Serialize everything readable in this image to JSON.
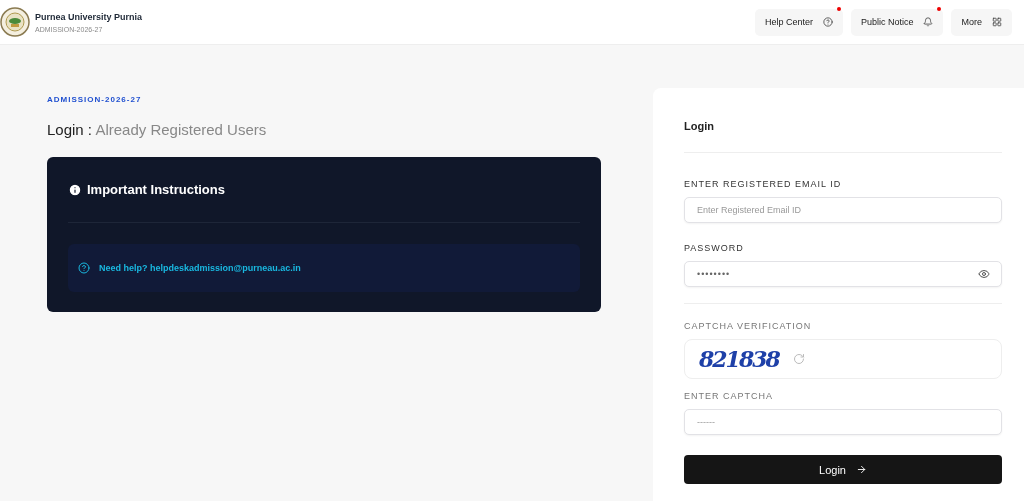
{
  "header": {
    "title": "Purnea University Purnia",
    "subtitle": "ADMISSION-2026-27",
    "nav": [
      {
        "label": "Help Center",
        "kind": "help",
        "notification": true
      },
      {
        "label": "Public Notice",
        "kind": "notice",
        "notification": true
      },
      {
        "label": "More",
        "kind": "more",
        "notification": false
      }
    ]
  },
  "intro": {
    "eyebrow": "ADMISSION-2026-27",
    "heading": "Login :",
    "subheading": "Already Registered Users"
  },
  "instructions": {
    "title": "Important Instructions",
    "help": "Need help? helpdeskadmission@purneau.ac.in"
  },
  "login": {
    "title": "Login",
    "fields": [
      {
        "kind": "email",
        "label": "ENTER REGISTERED EMAIL ID",
        "placeholder": "Enter Registered Email ID"
      },
      {
        "kind": "password",
        "label": "PASSWORD",
        "value": "••••••••"
      },
      {
        "kind": "captcha",
        "label": "CAPTCHA VERIFICATION",
        "code": "821838"
      },
      {
        "kind": "text",
        "label": "ENTER CAPTCHA",
        "placeholder": "------"
      }
    ],
    "button": "Login"
  }
}
